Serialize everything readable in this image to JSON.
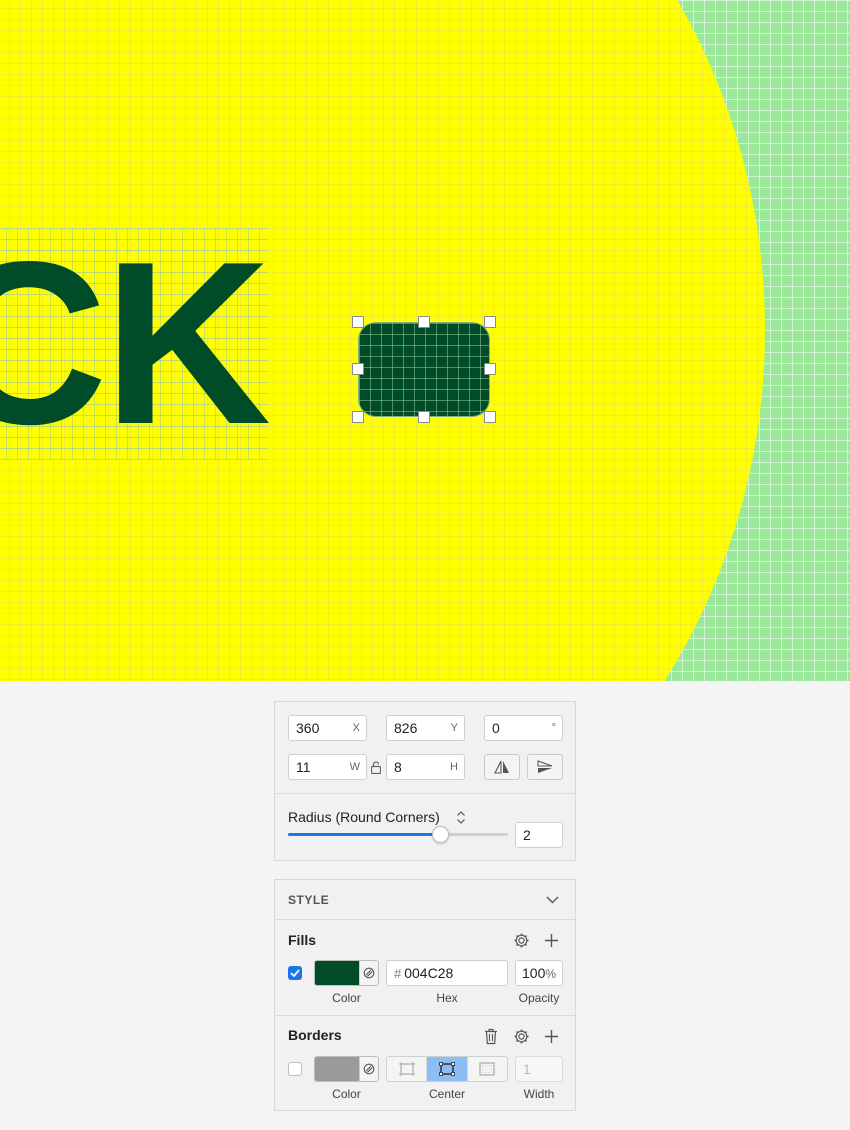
{
  "canvas": {
    "text": "CK",
    "fill_color": "#004C28",
    "background_color": "#9AE99A",
    "shape_color": "#FFFF00"
  },
  "geometry": {
    "x": {
      "value": "360",
      "suffix": "X"
    },
    "y": {
      "value": "826",
      "suffix": "Y"
    },
    "rotation": {
      "value": "0",
      "suffix": "°"
    },
    "w": {
      "value": "11",
      "suffix": "W"
    },
    "h": {
      "value": "8",
      "suffix": "H"
    }
  },
  "radius": {
    "label": "Radius (Round Corners)",
    "value": "2",
    "slider_fraction": 0.69
  },
  "style": {
    "header": "STYLE",
    "fills": {
      "title": "Fills",
      "enabled": true,
      "color": "#004C28",
      "hex_prefix": "#",
      "hex": "004C28",
      "opacity": "100",
      "opacity_unit": "%",
      "color_label": "Color",
      "hex_label": "Hex",
      "opacity_label": "Opacity"
    },
    "borders": {
      "title": "Borders",
      "enabled": false,
      "color": "#9A9A9A",
      "width_placeholder": "1",
      "color_label": "Color",
      "position_label": "Center",
      "width_label": "Width",
      "selected_position": "center"
    }
  }
}
